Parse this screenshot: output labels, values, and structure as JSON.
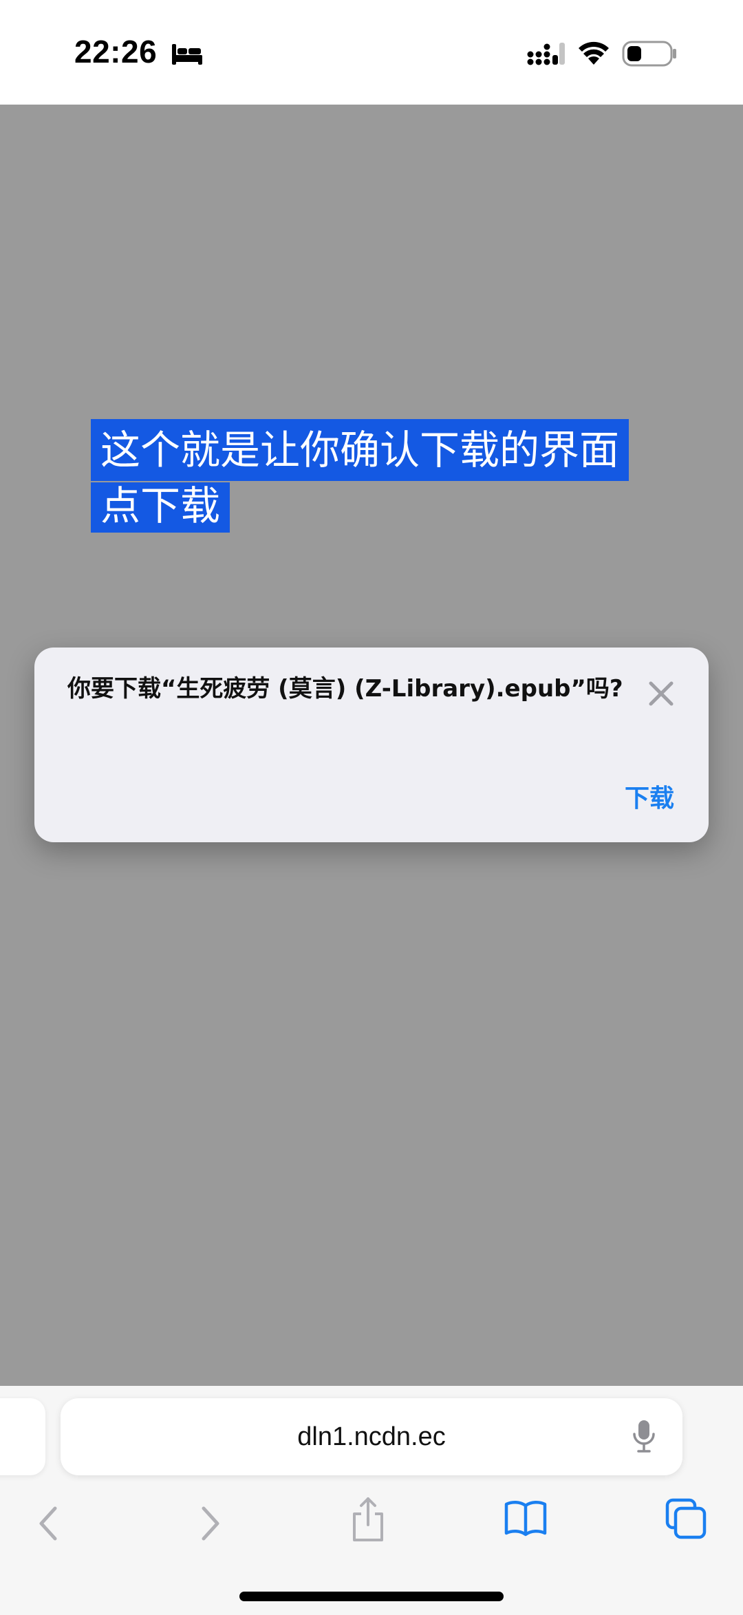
{
  "status_bar": {
    "time": "22:26",
    "icons": [
      "bed-icon",
      "signal-icon",
      "wifi-icon",
      "battery-icon"
    ]
  },
  "annotation": {
    "line1": "这个就是让你确认下载的界面",
    "line2": "点下载",
    "highlight_color": "#1459e3"
  },
  "dialog": {
    "message": "你要下载“生死疲劳 (莫言) (Z-Library).epub”吗?",
    "download_label": "下载",
    "accent_color": "#1a7ff0"
  },
  "browser": {
    "address": "dln1.ncdn.ec",
    "toolbar_icons": [
      "back-icon",
      "forward-icon",
      "share-icon",
      "bookmarks-icon",
      "tabs-icon",
      "mic-icon"
    ]
  }
}
